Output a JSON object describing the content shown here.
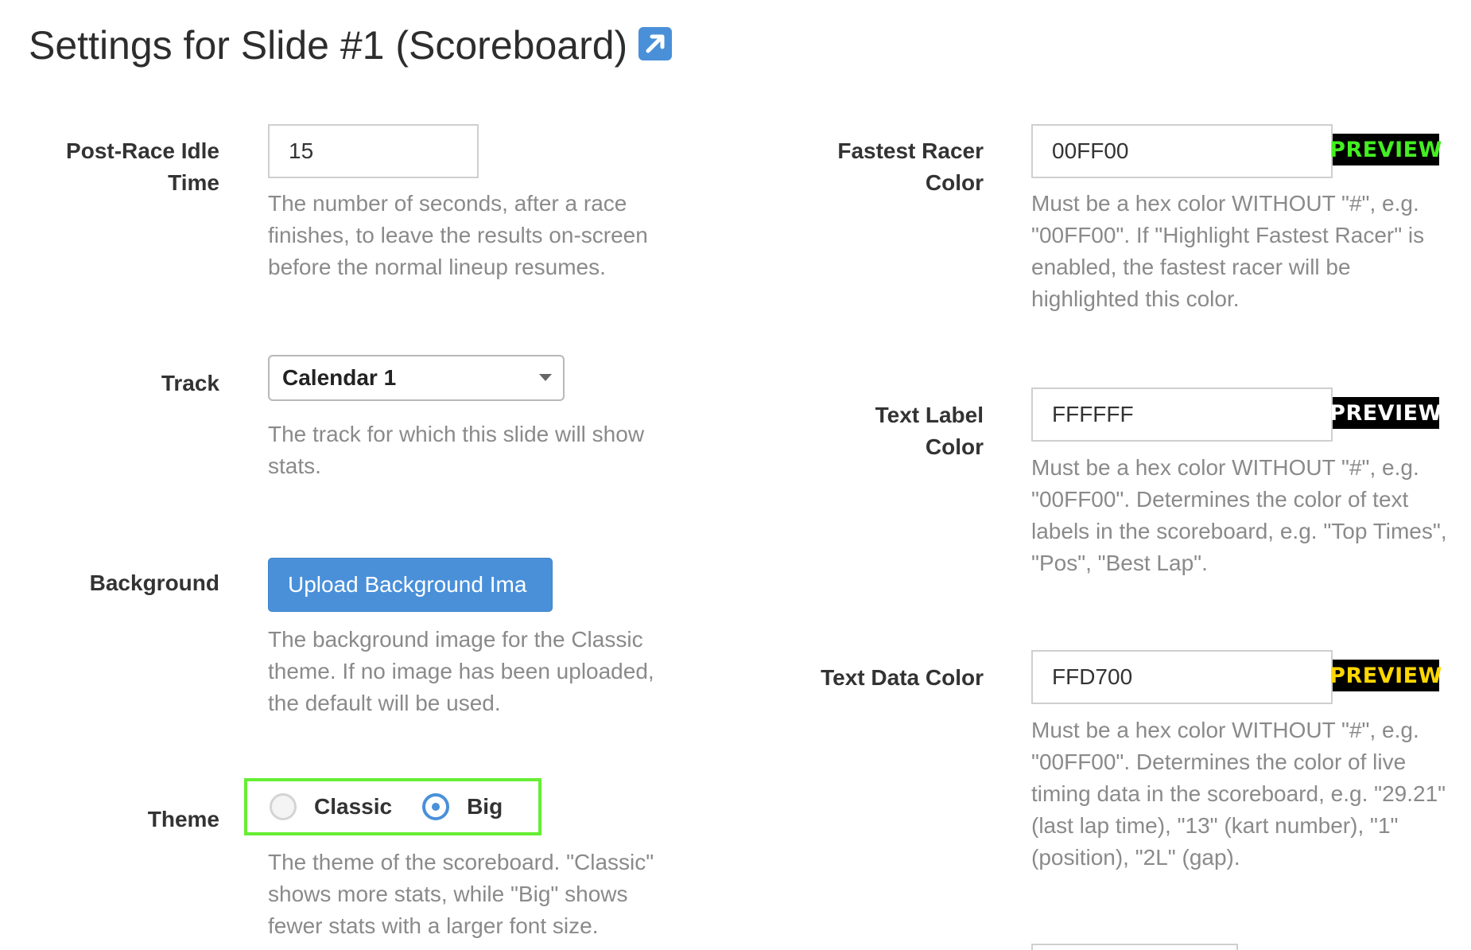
{
  "header": {
    "title": "Settings for Slide #1 (Scoreboard)",
    "external_link_icon": "external-link-icon"
  },
  "left": {
    "idle_time": {
      "label_line1": "Post-Race Idle",
      "label_line2": "Time",
      "value": "15",
      "help": [
        "The number of seconds, after a race",
        "finishes, to leave the results on-screen",
        "before the normal lineup resumes."
      ]
    },
    "track": {
      "label": "Track",
      "selected": "Calendar 1",
      "help": [
        "The track for which this slide will show",
        "stats."
      ]
    },
    "background": {
      "label": "Background",
      "button_label": "Upload Background Ima",
      "help": [
        "The background image for the Classic",
        "theme. If no image has been uploaded,",
        "the default will be used."
      ]
    },
    "theme": {
      "label": "Theme",
      "options": [
        {
          "label": "Classic",
          "selected": false
        },
        {
          "label": "Big",
          "selected": true
        }
      ],
      "highlight_color": "#66ee33",
      "help": [
        "The theme of the scoreboard. \"Classic\"",
        "shows more stats, while \"Big\" shows",
        "fewer stats with a larger font size."
      ]
    }
  },
  "right": {
    "fastest_racer": {
      "label_line1": "Fastest Racer",
      "label_line2": "Color",
      "value": "00FF00",
      "preview_label": "PREVIEW",
      "preview_color": "#44ee22",
      "help": [
        "Must be a hex color WITHOUT \"#\", e.g.",
        "\"00FF00\". If \"Highlight Fastest Racer\" is",
        "enabled, the fastest racer will be",
        "highlighted this color."
      ]
    },
    "text_label": {
      "label_line1": "Text Label",
      "label_line2": "Color",
      "value": "FFFFFF",
      "preview_label": "PREVIEW",
      "preview_color": "#ffffff",
      "help": [
        "Must be a hex color WITHOUT \"#\", e.g.",
        "\"00FF00\". Determines the color of text",
        "labels in the scoreboard, e.g. \"Top Times\",",
        "\"Pos\", \"Best Lap\"."
      ]
    },
    "text_data": {
      "label": "Text Data Color",
      "value": "FFD700",
      "preview_label": "PREVIEW",
      "preview_color": "#ffd700",
      "help": [
        "Must be a hex color WITHOUT \"#\", e.g.",
        "\"00FF00\". Determines the color of live",
        "timing data in the scoreboard, e.g. \"29.21\"",
        "(last lap time), \"13\" (kart number), \"1\"",
        "(position), \"2L\" (gap)."
      ]
    }
  },
  "colors": {
    "accent": "#4a90d9",
    "help_text": "#8a8a8a"
  }
}
